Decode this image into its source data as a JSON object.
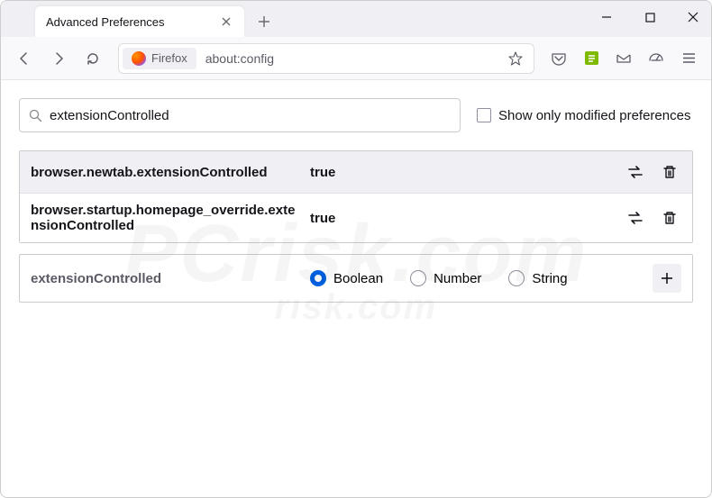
{
  "window": {
    "tab_title": "Advanced Preferences"
  },
  "toolbar": {
    "firefox_label": "Firefox",
    "url": "about:config"
  },
  "content": {
    "search_value": "extensionControlled",
    "show_modified_label": "Show only modified preferences",
    "prefs": [
      {
        "name": "browser.newtab.extensionControlled",
        "value": "true"
      },
      {
        "name": "browser.startup.homepage_override.extensionControlled",
        "value": "true"
      }
    ],
    "new_pref_name": "extensionControlled",
    "types": {
      "boolean": "Boolean",
      "number": "Number",
      "string": "String"
    }
  },
  "watermark": {
    "main": "PCrisk.com",
    "sub": "rısk.com"
  }
}
